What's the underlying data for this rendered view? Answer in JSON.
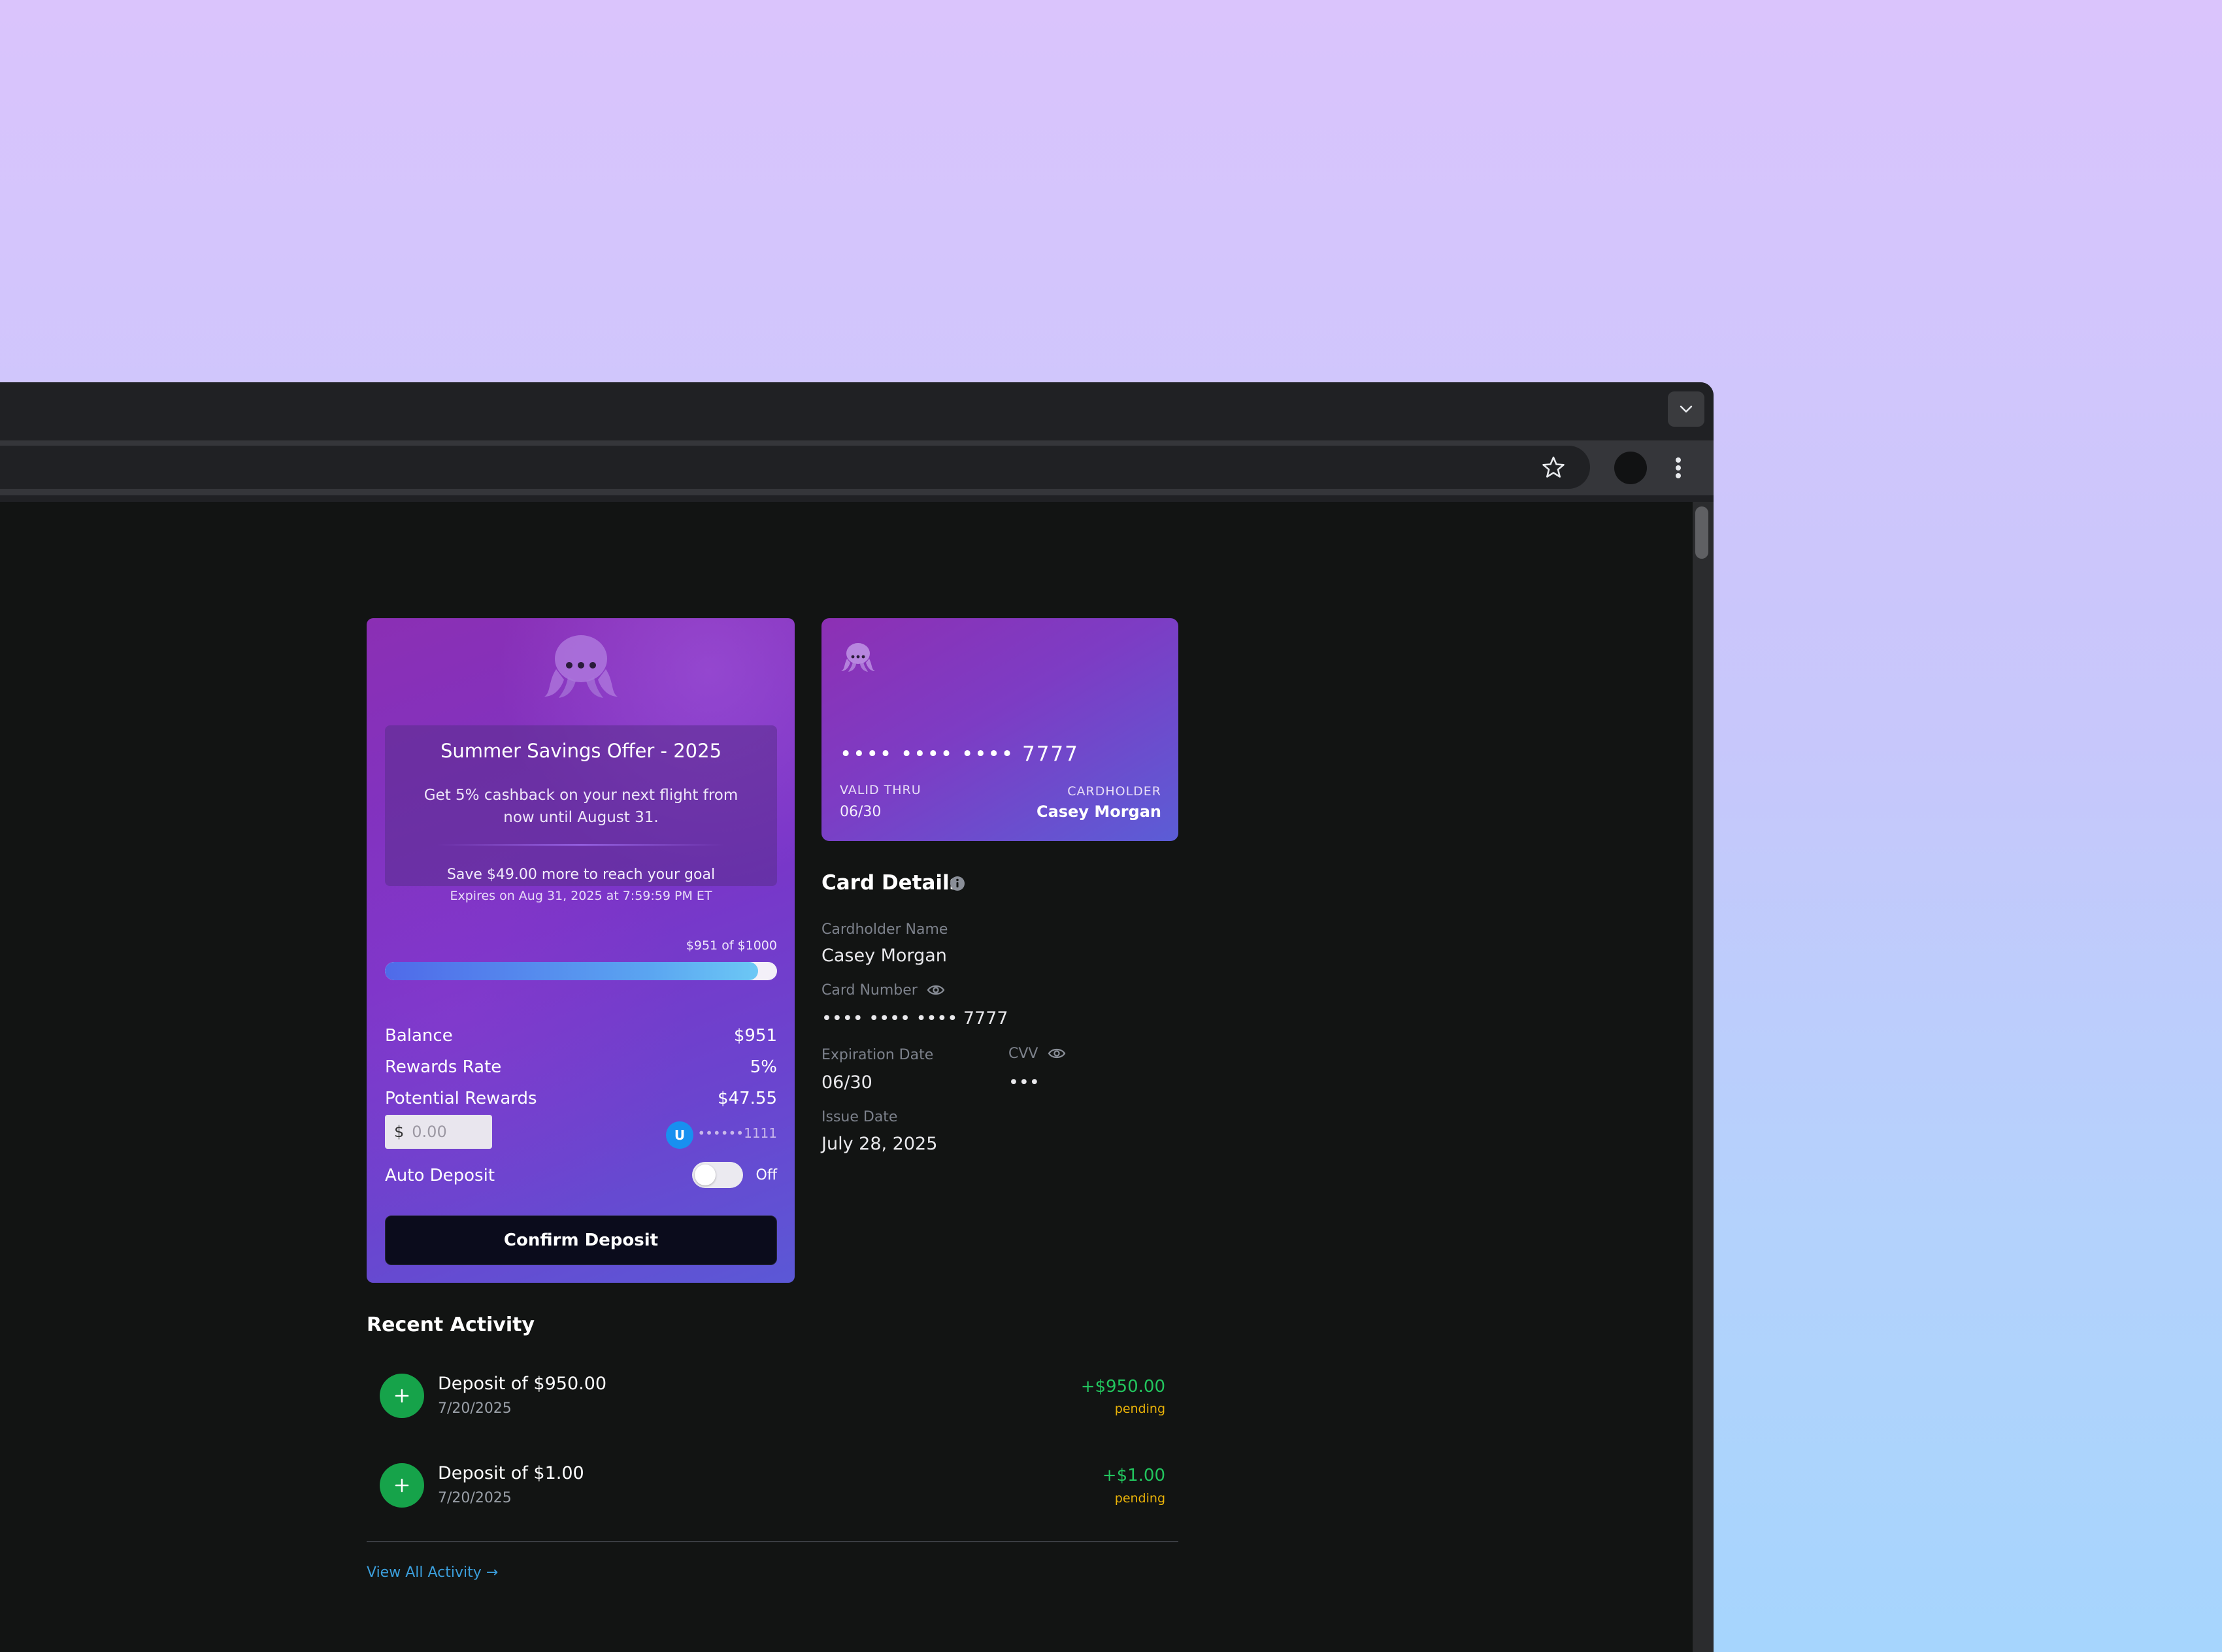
{
  "browser": {
    "tab_dropdown_icon": "chevron-down-icon",
    "bookmark_icon": "star-icon",
    "menu_icon": "more-vert-icon"
  },
  "savings": {
    "offer_title": "Summer Savings Offer - 2025",
    "offer_description": "Get 5% cashback on your next flight from now until August 31.",
    "goal_text": "Save $49.00 more to reach your goal",
    "expiry_text": "Expires on Aug 31, 2025 at 7:59:59 PM ET",
    "progress_caption": "$951 of  $1000",
    "progress_current": 951,
    "progress_goal": 1000,
    "stats": [
      {
        "label": "Balance",
        "value": "$951"
      },
      {
        "label": "Rewards Rate",
        "value": "5%"
      },
      {
        "label": "Potential Rewards",
        "value": "$47.55"
      }
    ],
    "currency_symbol": "$",
    "amount_placeholder": "0.00",
    "account_badge": "U",
    "account_mask": "••••••1111",
    "auto_deposit_label": "Auto Deposit",
    "auto_deposit_state": "Off",
    "confirm_label": "Confirm Deposit"
  },
  "card": {
    "number": "•••• •••• •••• 7777",
    "valid_thru_label": "VALID THRU",
    "valid_thru": "06/30",
    "cardholder_label": "CARDHOLDER",
    "cardholder": "Casey Morgan"
  },
  "details": {
    "title": "Card Details",
    "name_label": "Cardholder Name",
    "name_value": "Casey Morgan",
    "number_label": "Card Number",
    "number_value": "•••• •••• •••• 7777",
    "expiration_label": "Expiration Date",
    "expiration_value": "06/30",
    "cvv_label": "CVV",
    "cvv_value": "•••",
    "issue_label": "Issue Date",
    "issue_value": "July 28, 2025"
  },
  "activity": {
    "title": "Recent Activity",
    "items": [
      {
        "name": "Deposit of $950.00",
        "date": "7/20/2025",
        "amount": "+$950.00",
        "status": "pending"
      },
      {
        "name": "Deposit of $1.00",
        "date": "7/20/2025",
        "amount": "+$1.00",
        "status": "pending"
      }
    ],
    "view_all": "View All Activity →"
  },
  "colors": {
    "page_bg": "#121413",
    "card_purple": "#7d3cc4",
    "positive": "#22c55e",
    "pending": "#eab308",
    "link": "#3b9edb",
    "activity_icon": "#16a34a"
  }
}
